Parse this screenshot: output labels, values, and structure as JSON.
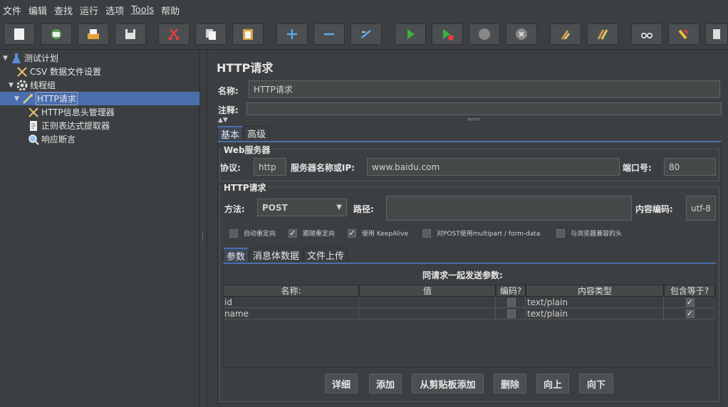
{
  "menu": [
    {
      "label": "文件"
    },
    {
      "label": "编辑"
    },
    {
      "label": "查找"
    },
    {
      "label": "运行"
    },
    {
      "label": "选项"
    },
    {
      "label": "Tools"
    },
    {
      "label": "帮助"
    }
  ],
  "tree": {
    "test_plan": "测试计划",
    "csv": "CSV 数据文件设置",
    "thread_group": "线程组",
    "http_request": "HTTP请求",
    "header_manager": "HTTP信息头管理器",
    "regex_extractor": "正则表达式提取器",
    "assertion": "响应断言"
  },
  "panel": {
    "title": "HTTP请求",
    "name_label": "名称:",
    "name_value": "HTTP请求",
    "comment_label": "注释:",
    "tabs": [
      "基本",
      "高级"
    ],
    "web_server_title": "Web服务器",
    "protocol_label": "协议:",
    "protocol_value": "http",
    "server_label": "服务器名称或IP:",
    "server_value": "www.baidu.com",
    "port_label": "端口号:",
    "port_value": "80",
    "http_request_title": "HTTP请求",
    "method_label": "方法:",
    "method_value": "POST",
    "path_label": "路径:",
    "path_value": "",
    "encoding_label": "内容编码:",
    "encoding_value": "utf-8",
    "options": [
      {
        "label": "自动重定向",
        "checked": false
      },
      {
        "label": "跟随重定向",
        "checked": true
      },
      {
        "label": "使用 KeepAlive",
        "checked": true
      },
      {
        "label": "对POST使用multipart / form-data",
        "checked": false
      },
      {
        "label": "与浏览器兼容的头",
        "checked": false
      }
    ],
    "param_tabs": [
      "参数",
      "消息体数据",
      "文件上传"
    ],
    "params_caption": "同请求一起发送参数:",
    "columns": [
      "名称:",
      "值",
      "编码?",
      "内容类型",
      "包含等于?"
    ],
    "rows": [
      {
        "name": "id",
        "value": "",
        "encode": false,
        "content_type": "text/plain",
        "include_equals": true
      },
      {
        "name": "name",
        "value": "",
        "encode": false,
        "content_type": "text/plain",
        "include_equals": true
      }
    ],
    "buttons": [
      "详细",
      "添加",
      "从剪贴板添加",
      "删除",
      "向上",
      "向下"
    ]
  },
  "colors": {
    "selection": "#4b6eaf",
    "background": "#3c3f41"
  }
}
